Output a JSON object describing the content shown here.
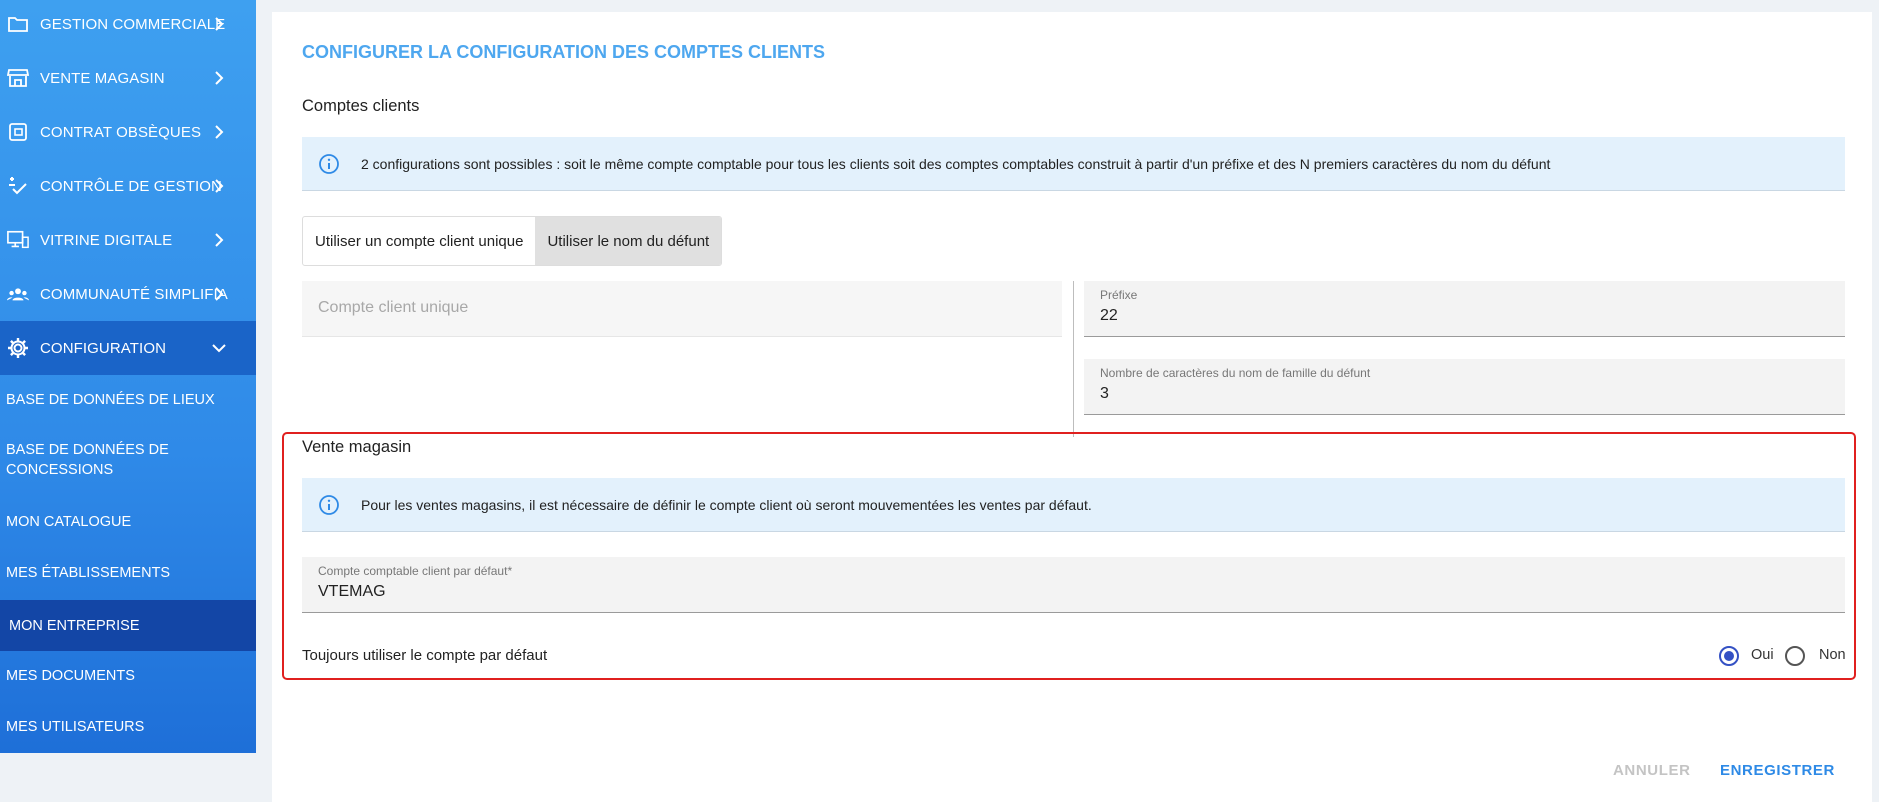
{
  "sidebar": {
    "items": [
      {
        "label": "GESTION COMMERCIALE",
        "icon": "folder-icon"
      },
      {
        "label": "VENTE MAGASIN",
        "icon": "store-icon"
      },
      {
        "label": "CONTRAT OBSÈQUES",
        "icon": "contract-icon"
      },
      {
        "label": "CONTRÔLE DE GESTION",
        "icon": "control-check-icon"
      },
      {
        "label": "VITRINE DIGITALE",
        "icon": "monitor-icon"
      },
      {
        "label": "COMMUNAUTÉ SIMPLIFIA",
        "icon": "community-icon"
      },
      {
        "label": "CONFIGURATION",
        "icon": "gear-icon"
      }
    ],
    "sub_items": [
      {
        "label": "BASE DE DONNÉES DE LIEUX"
      },
      {
        "label": "BASE DE DONNÉES DE CONCESSIONS"
      },
      {
        "label": "MON CATALOGUE"
      },
      {
        "label": "MES ÉTABLISSEMENTS"
      },
      {
        "label": "MON ENTREPRISE"
      },
      {
        "label": "MES DOCUMENTS"
      },
      {
        "label": "MES UTILISATEURS"
      }
    ]
  },
  "main": {
    "page_title": "CONFIGURER LA CONFIGURATION DES COMPTES CLIENTS",
    "comptes_clients": {
      "title": "Comptes clients",
      "info": "2 configurations sont possibles : soit le même compte comptable pour tous les clients soit des comptes comptables construit à partir d'un préfixe et des N premiers caractères du nom du défunt",
      "toggle": {
        "option_unique": "Utiliser un compte client unique",
        "option_nom": "Utiliser le nom du défunt",
        "selected": "Utiliser le nom du défunt"
      },
      "compte_unique_placeholder": "Compte client unique",
      "prefixe": {
        "label": "Préfixe",
        "value": "22"
      },
      "nb_caracteres": {
        "label": "Nombre de caractères du nom de famille du défunt",
        "value": "3"
      }
    },
    "vente_magasin": {
      "title": "Vente magasin",
      "info": "Pour les ventes magasins, il est nécessaire de définir le compte client où seront mouvementées les ventes par défaut.",
      "compte_defaut": {
        "label": "Compte comptable client par défaut*",
        "value": "VTEMAG"
      },
      "toujours_label": "Toujours utiliser le compte par défaut",
      "oui_label": "Oui",
      "non_label": "Non",
      "selected": "Oui"
    },
    "actions": {
      "cancel_label": "ANNULER",
      "save_label": "ENREGISTRER"
    }
  },
  "colors": {
    "accent": "#2e8ae6",
    "title": "#4ea7ef",
    "info_bg": "#e3f1fc",
    "highlight_border": "#e0201f",
    "radio_checked": "#3451c4"
  }
}
